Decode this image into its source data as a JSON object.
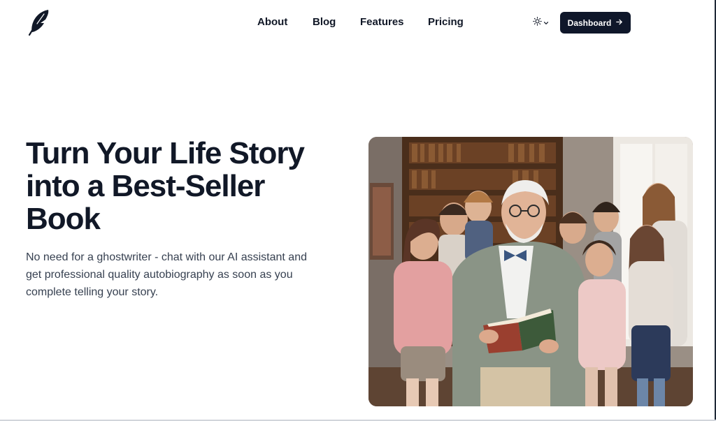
{
  "header": {
    "logo_icon": "feather-icon",
    "nav": [
      {
        "label": "About"
      },
      {
        "label": "Blog"
      },
      {
        "label": "Features"
      },
      {
        "label": "Pricing"
      }
    ],
    "theme_toggle_icon": "sun-icon",
    "dashboard_button": {
      "label": "Dashboard",
      "icon": "arrow-right-icon"
    }
  },
  "hero": {
    "title": "Turn Your Life Story into a Best-Seller Book",
    "subtitle": "No need for a ghostwriter - chat with our AI assistant and get professional quality autobiography as soon as you complete telling your story."
  },
  "colors": {
    "primary": "#0f172a",
    "text": "#111827",
    "muted_text": "#374151",
    "background": "#ffffff"
  }
}
